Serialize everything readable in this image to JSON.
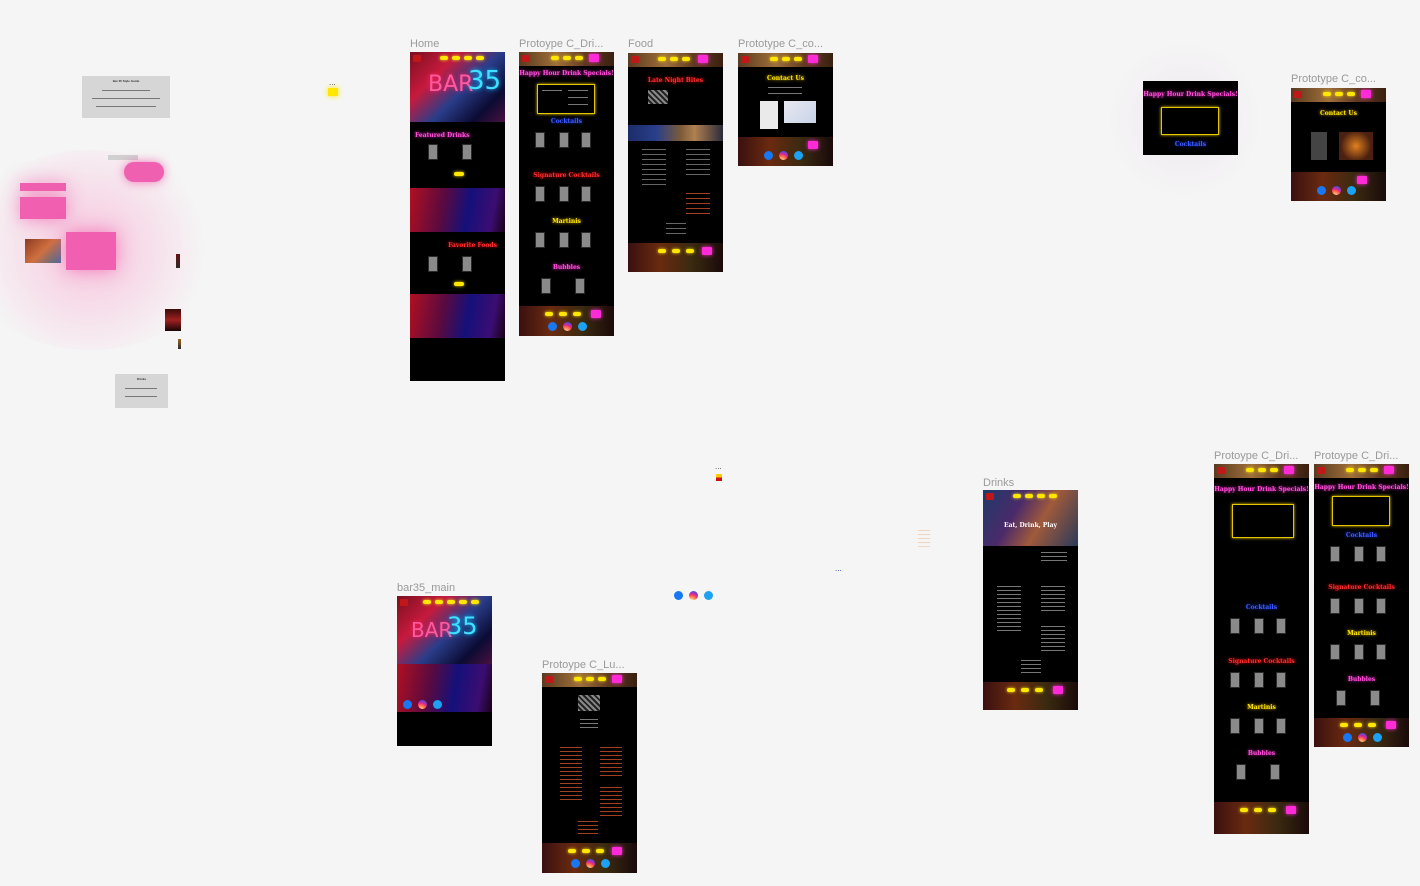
{
  "canvas": {
    "frame_labels": {
      "home": "Home",
      "proto_drinks_1": "Protoype C_Dri...",
      "food": "Food",
      "proto_contact_1": "Prototype C_co...",
      "proto_contact_2": "Prototype C_co...",
      "proto_drinks_2": "Protoype C_Dri...",
      "proto_drinks_3": "Protoype C_Dri...",
      "drinks": "Drinks",
      "bar35_main": "bar35_main",
      "proto_lunch": "Protoype C_Lu..."
    },
    "ellipsis": "...",
    "headings": {
      "happy_hour": "Happy Hour Drink Specials!",
      "featured_drinks": "Featured Drinks",
      "favorite_foods": "Favorite Foods",
      "late_night_bites": "Late Night Bites",
      "contact_us": "Contact Us",
      "cocktails": "Cocktails",
      "signature_cocktails": "Signature Cocktails",
      "martinis": "Martinis",
      "bubbles": "Bubbles",
      "eat_drink_play": "Eat, Drink, Play"
    },
    "notes": {
      "style_guide_title": "Bar 35 Style Guide",
      "drinks_note_title": "Drinks"
    }
  },
  "colors": {
    "canvas_bg": "#f5f5f5",
    "neon_pink": "#ff2bd6",
    "neon_yellow": "#ffe700",
    "neon_red": "#ff3030",
    "neon_blue": "#3b5cff",
    "frame_bg": "#000000"
  }
}
